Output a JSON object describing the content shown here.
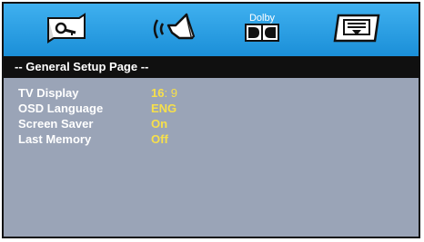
{
  "toolbar": {
    "icons": [
      {
        "name": "general-setup-icon"
      },
      {
        "name": "speaker-setup-icon"
      },
      {
        "name": "dolby-digital-icon",
        "label": "Dolby"
      },
      {
        "name": "preference-icon"
      }
    ]
  },
  "page": {
    "title": "-- General Setup Page --"
  },
  "settings": [
    {
      "label": "TV Display",
      "value": "16:9",
      "value_main": "16",
      "value_sep": ":",
      "value_den": "9"
    },
    {
      "label": "OSD Language",
      "value": "ENG"
    },
    {
      "label": "Screen Saver",
      "value": "On"
    },
    {
      "label": "Last Memory",
      "value": "Off"
    }
  ],
  "colors": {
    "toolbar": "#2aa1e6",
    "title_bar": "#101010",
    "body": "#9aa4b7",
    "label": "#ffffff",
    "value": "#f7e04a"
  }
}
